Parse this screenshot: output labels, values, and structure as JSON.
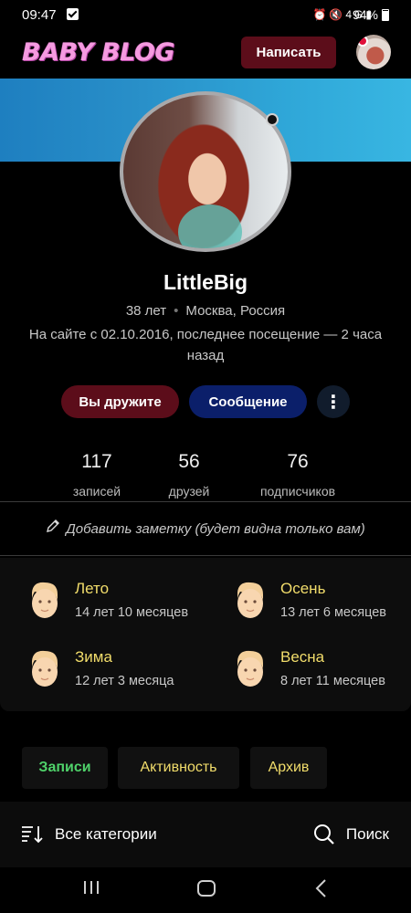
{
  "status_bar": {
    "time": "09:47",
    "network": "4G",
    "battery": "94%"
  },
  "app_bar": {
    "logo": "BABY BLOG",
    "write_label": "Написать"
  },
  "profile": {
    "username": "LittleBig",
    "age": "38 лет",
    "location": "Москва, Россия",
    "since": "На сайте с 02.10.2016, последнее посещение — 2 часа назад",
    "friends_label": "Вы дружите",
    "message_label": "Сообщение",
    "more_label": "⋮"
  },
  "stats": [
    {
      "value": "117",
      "label": "записей"
    },
    {
      "value": "56",
      "label": "друзей"
    },
    {
      "value": "76",
      "label": "подписчиков"
    }
  ],
  "note": "Добавить заметку (будет видна только вам)",
  "children": [
    {
      "name": "Лето",
      "age": "14 лет 10 месяцев"
    },
    {
      "name": "Осень",
      "age": "13 лет 6 месяцев"
    },
    {
      "name": "Зима",
      "age": "12 лет 3 месяца"
    },
    {
      "name": "Весна",
      "age": "8 лет 11 месяцев"
    }
  ],
  "tabs": [
    {
      "label": "Записи",
      "active": true
    },
    {
      "label": "Активность",
      "active": false
    },
    {
      "label": "Архив",
      "active": false
    }
  ],
  "filter": {
    "categories_label": "Все категории",
    "search_label": "Поиск"
  },
  "colors": {
    "accent_red": "#5c0d1a",
    "accent_blue": "#0b1f6a",
    "tab_green": "#4fd26a",
    "gold": "#f2dd6b",
    "logo_pink": "#f59ae0"
  },
  "icons": [
    "check-icon",
    "alarm-icon",
    "mute-icon",
    "signal-icon",
    "battery-icon",
    "more-vertical-icon",
    "pencil-icon",
    "child-face-icon",
    "sort-icon",
    "search-icon",
    "recents-icon",
    "home-icon",
    "back-icon"
  ]
}
